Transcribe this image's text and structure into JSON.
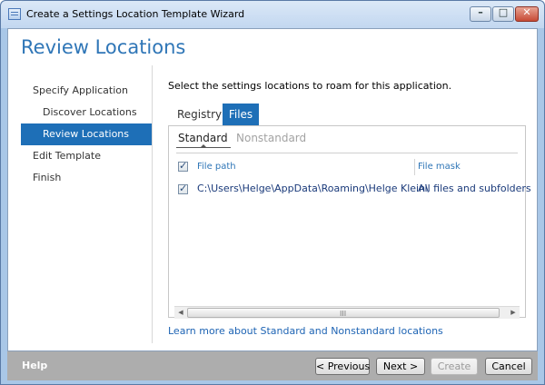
{
  "window": {
    "title": "Create a Settings Location Template Wizard",
    "minimize": "–",
    "maximize": "□",
    "close": "✕"
  },
  "page": {
    "title": "Review Locations",
    "instruction": "Select the settings locations to roam for this application."
  },
  "nav": {
    "items": [
      {
        "label": "Specify Application",
        "active": false
      },
      {
        "label": "Discover Locations",
        "active": false
      },
      {
        "label": "Review Locations",
        "active": true
      },
      {
        "label": "Edit Template",
        "active": false
      },
      {
        "label": "Finish",
        "active": false
      }
    ]
  },
  "tabs": {
    "registry": "Registry",
    "files": "Files",
    "selected": "Files"
  },
  "subtabs": {
    "standard": "Standard",
    "nonstandard": "Nonstandard",
    "selected": "Standard"
  },
  "grid": {
    "columns": [
      "File path",
      "File mask"
    ],
    "header_checked": true,
    "rows": [
      {
        "checked": true,
        "file_path": "C:\\Users\\Helge\\AppData\\Roaming\\Helge Klein\\",
        "file_mask": "All files and subfolders"
      }
    ]
  },
  "scrollbar": {
    "left_arrow": "◀",
    "right_arrow": "▶",
    "grip": "III"
  },
  "link": {
    "label": "Learn more about Standard and Nonstandard locations"
  },
  "footer": {
    "help": "Help",
    "previous": "< Previous",
    "next": "Next >",
    "create": "Create",
    "cancel": "Cancel"
  },
  "colors": {
    "accent": "#1e6fb7",
    "title": "#2f76b7",
    "footer": "#adadad"
  }
}
